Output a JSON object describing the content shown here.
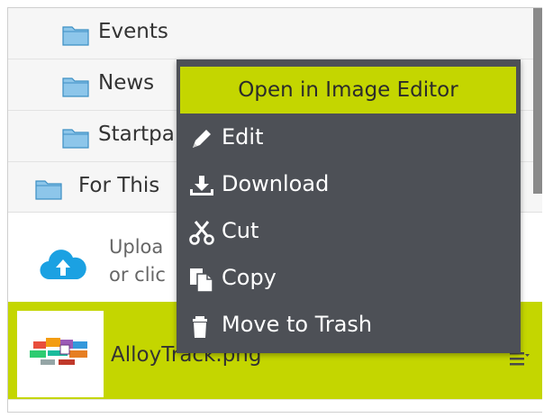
{
  "tree": {
    "items": [
      {
        "label": "Events"
      },
      {
        "label": "News"
      },
      {
        "label": "Startpa"
      },
      {
        "label": "For This"
      }
    ]
  },
  "upload": {
    "line1": "Uploa",
    "line2": "or clic"
  },
  "file": {
    "name": "AlloyTrack.png"
  },
  "context_menu": {
    "header": "Open in Image Editor",
    "items": [
      {
        "label": "Edit",
        "icon": "pencil-icon"
      },
      {
        "label": "Download",
        "icon": "download-icon"
      },
      {
        "label": "Cut",
        "icon": "scissors-icon"
      },
      {
        "label": "Copy",
        "icon": "copy-icon"
      },
      {
        "label": "Move to Trash",
        "icon": "trash-icon"
      }
    ]
  },
  "colors": {
    "accent": "#c4d600",
    "menu_bg": "#4d5056",
    "cloud": "#1ba1e2"
  }
}
